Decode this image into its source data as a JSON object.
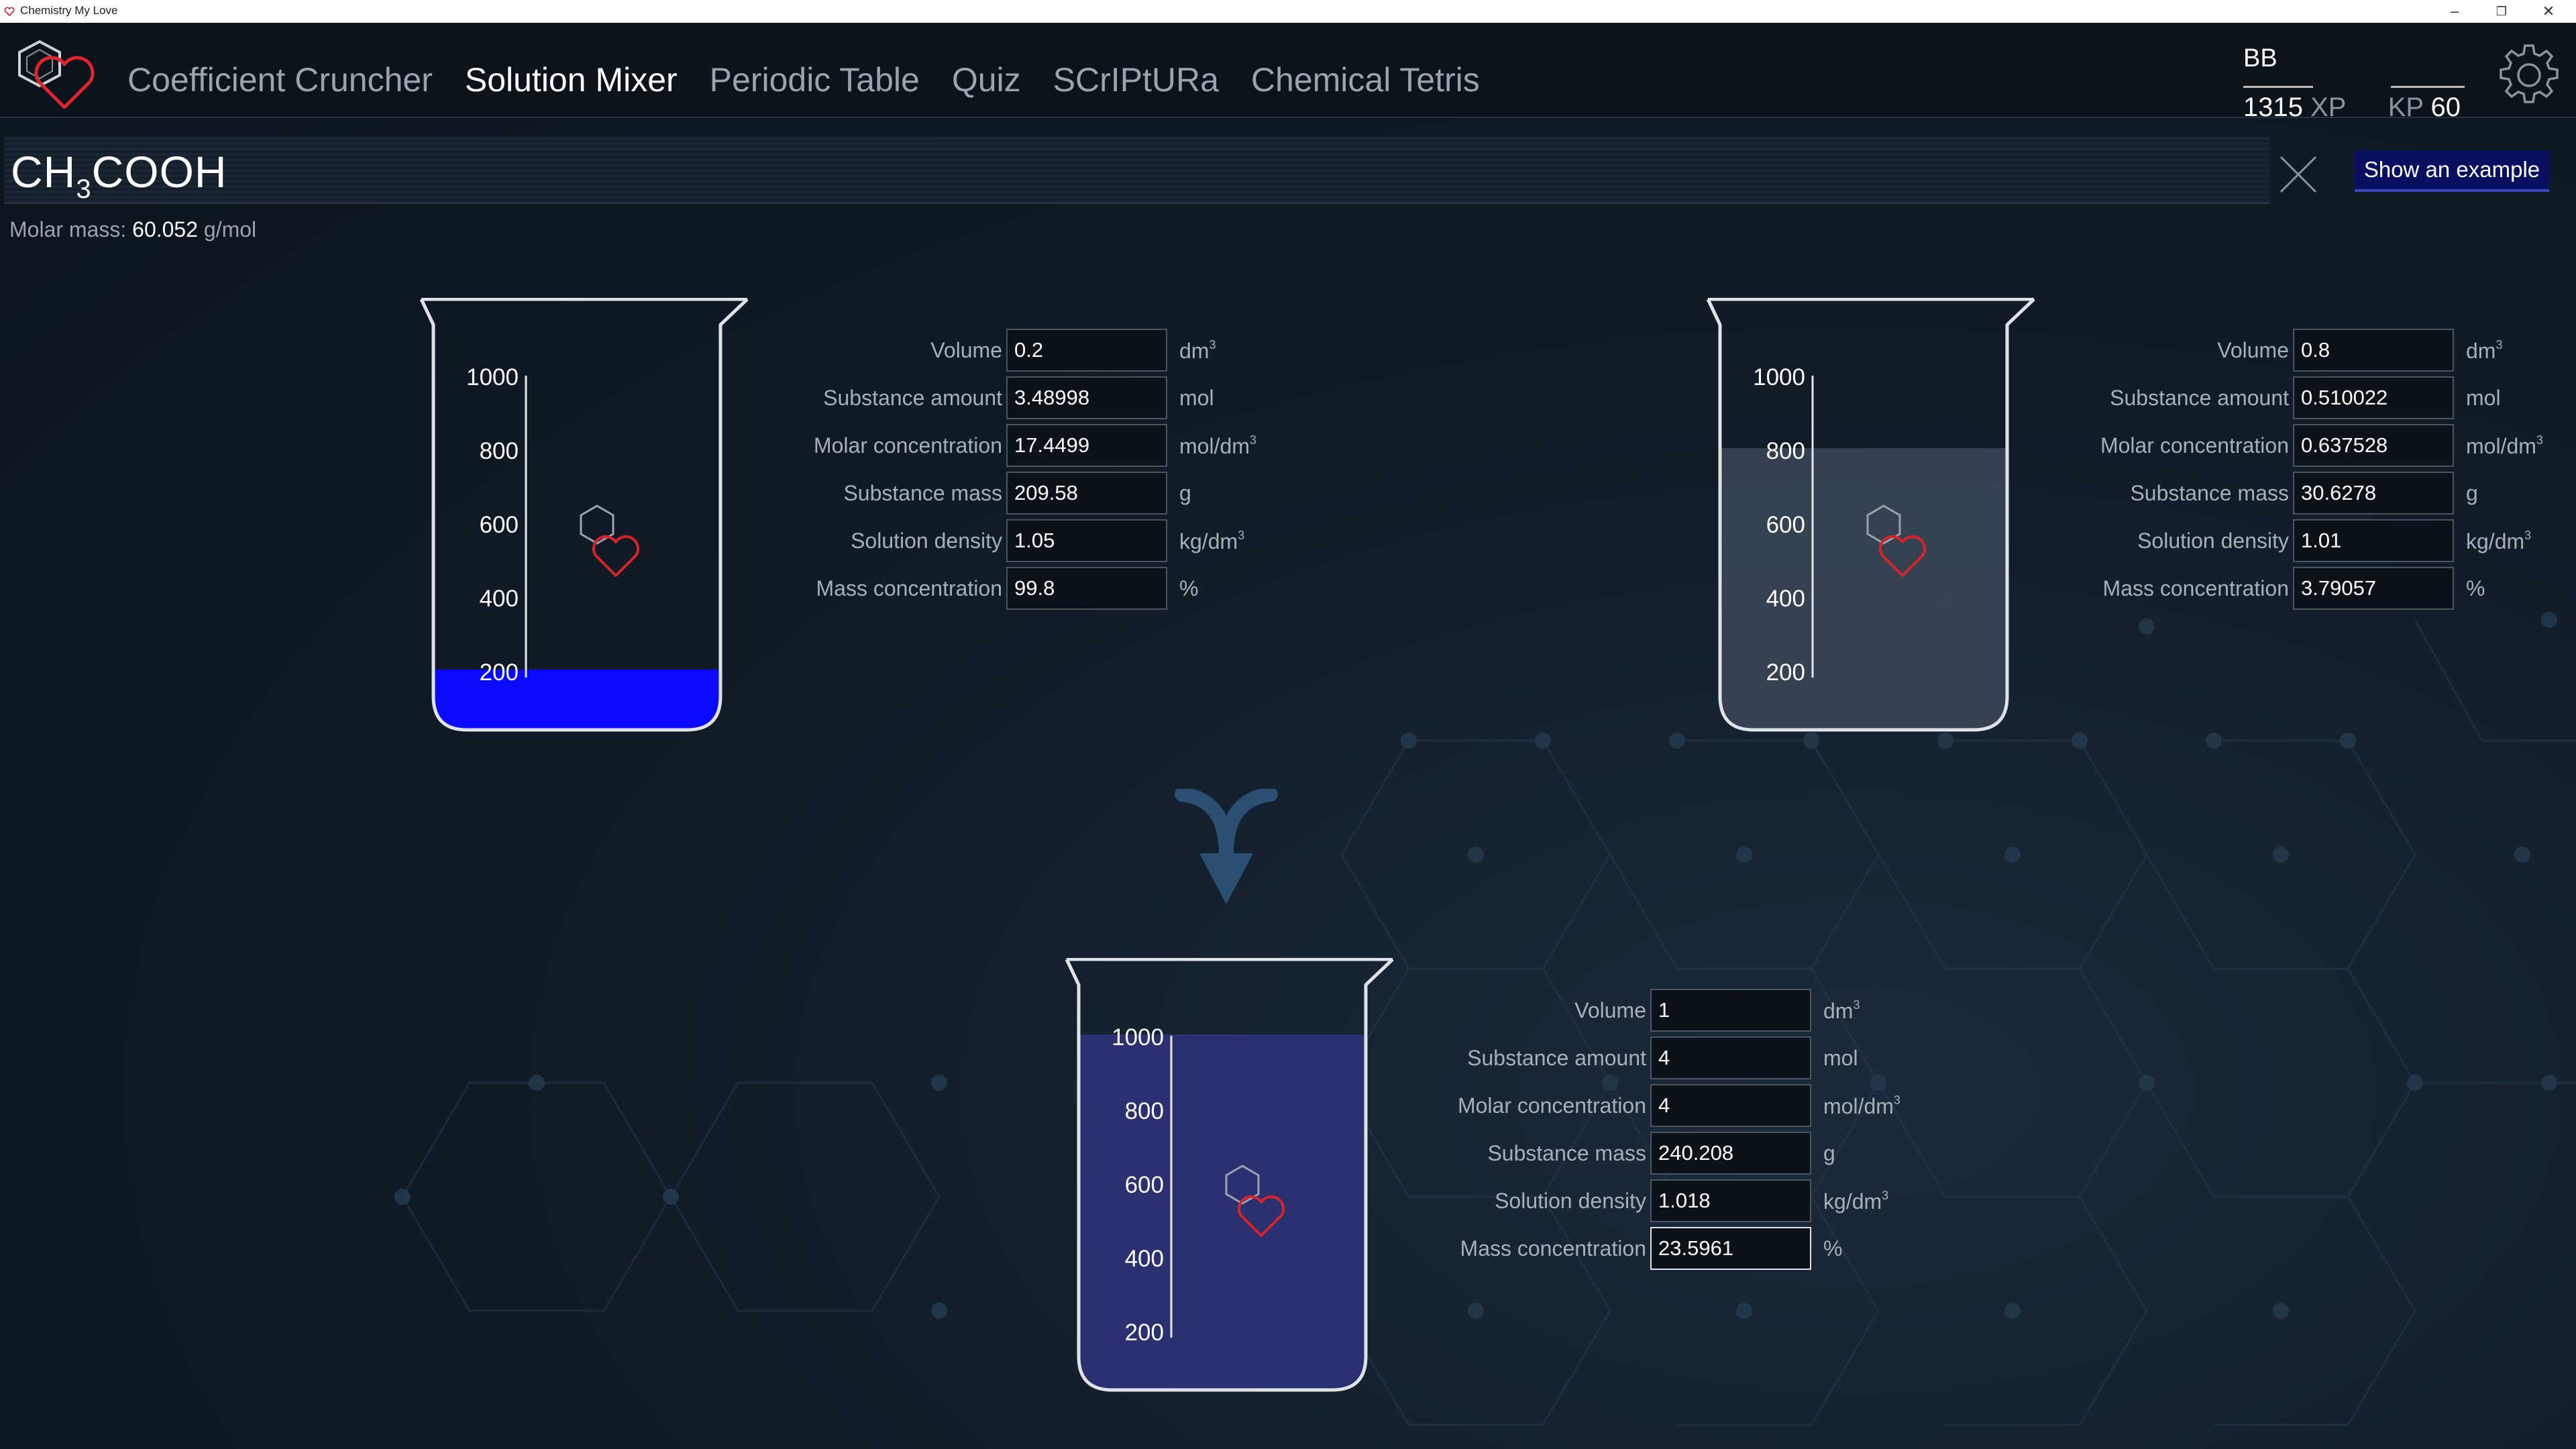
{
  "window": {
    "title": "Chemistry My Love"
  },
  "nav": {
    "items": [
      "Coefficient Cruncher",
      "Solution Mixer",
      "Periodic Table",
      "Quiz",
      "SCrIPtURa",
      "Chemical Tetris"
    ],
    "active": "Solution Mixer"
  },
  "user": {
    "name": "BB",
    "xp_value": "1315",
    "xp_label": "XP",
    "kp_label": "KP",
    "kp_value": "60"
  },
  "formula": {
    "base1": "CH",
    "sub1": "3",
    "base2": "COOH"
  },
  "example_button": "Show an example",
  "molar_mass": {
    "label": "Molar mass:",
    "value": "60.052",
    "unit": "g/mol"
  },
  "scale_ticks": [
    "1000",
    "800",
    "600",
    "400",
    "200"
  ],
  "labels": {
    "volume": "Volume",
    "amount": "Substance amount",
    "molar_conc": "Molar concentration",
    "mass": "Substance mass",
    "density": "Solution density",
    "mass_conc": "Mass concentration"
  },
  "units": {
    "volume": "dm",
    "volume_exp": "3",
    "amount": "mol",
    "molar_conc": "mol/dm",
    "molar_conc_exp": "3",
    "mass": "g",
    "density": "kg/dm",
    "density_exp": "3",
    "mass_conc": "%"
  },
  "solution1": {
    "volume": "0.2",
    "amount": "3.48998",
    "molar_conc": "17.4499",
    "mass": "209.58",
    "density": "1.05",
    "mass_conc": "99.8",
    "liquid_color": "#0a0aff",
    "fill_fraction": 0.2
  },
  "solution2": {
    "volume": "0.8",
    "amount": "0.510022",
    "molar_conc": "0.637528",
    "mass": "30.6278",
    "density": "1.01",
    "mass_conc": "3.79057",
    "liquid_color": "#3a4656",
    "fill_fraction": 0.8
  },
  "result": {
    "volume": "1",
    "amount": "4",
    "molar_conc": "4",
    "mass": "240.208",
    "density": "1.018",
    "mass_conc": "23.5961",
    "liquid_color": "#2c3274",
    "fill_fraction": 1.0
  }
}
